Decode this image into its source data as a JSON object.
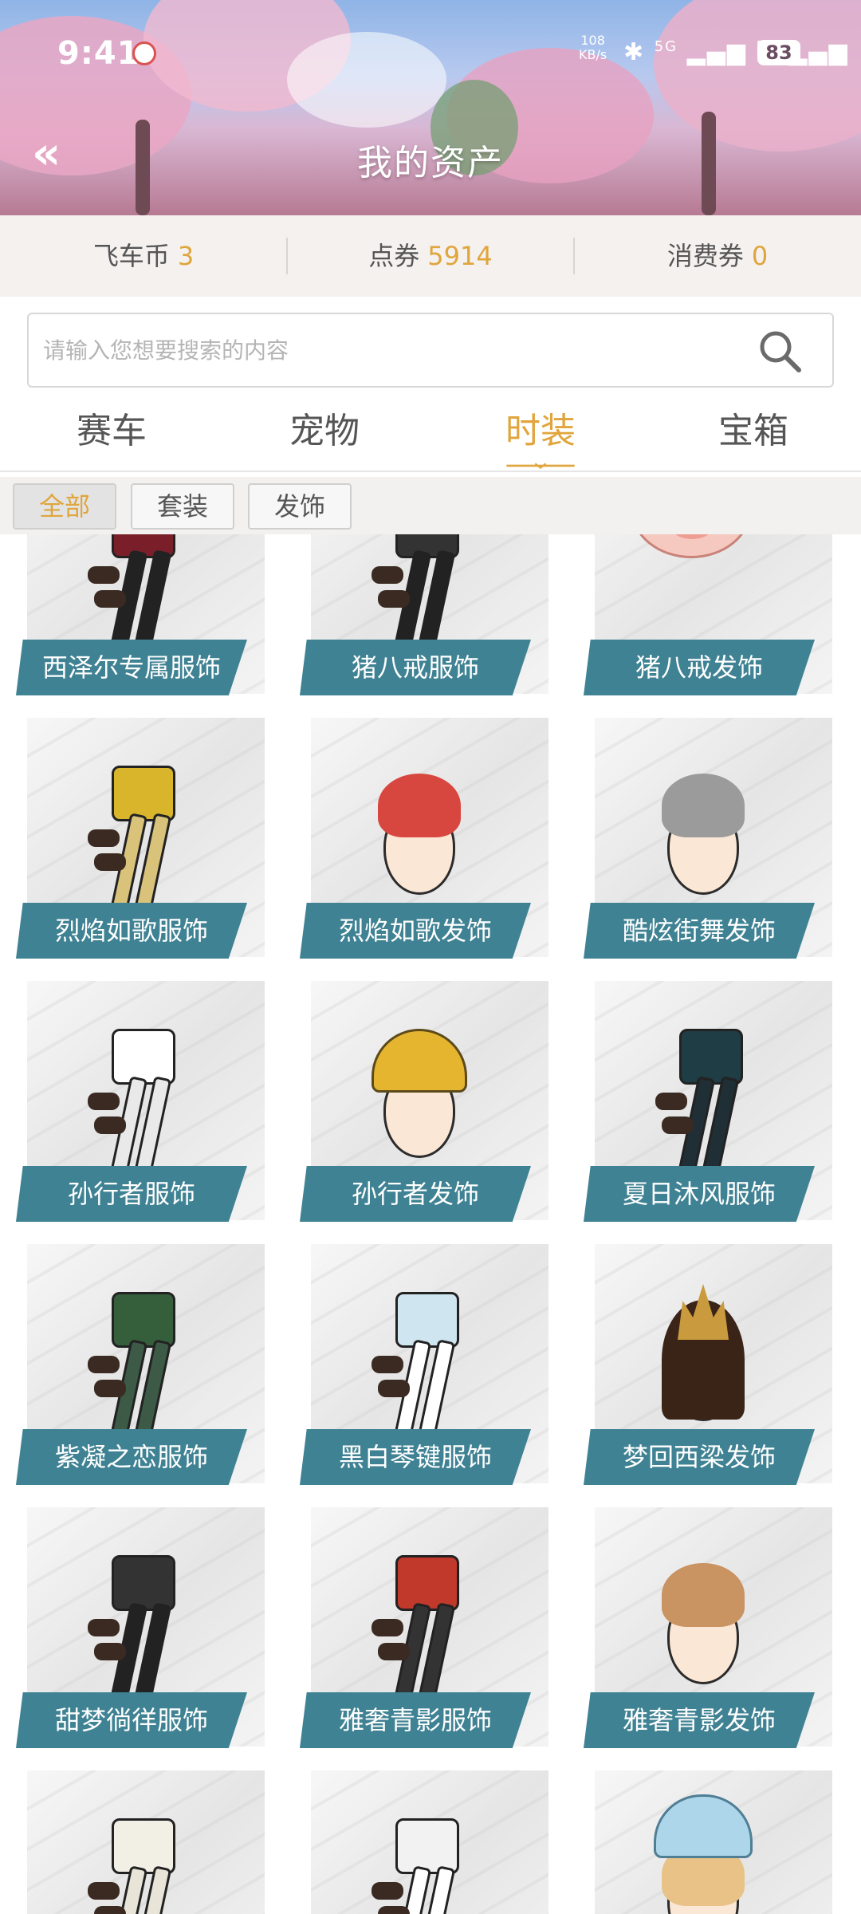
{
  "status_bar": {
    "time": "9:41",
    "net_speed_value": "108",
    "net_speed_unit": "KB/s",
    "signal_1": "5G",
    "signal_2": "5G",
    "battery": "83"
  },
  "header": {
    "title": "我的资产",
    "back_icon": "double-chevron-left-icon"
  },
  "balances": [
    {
      "label": "飞车币",
      "value": "3"
    },
    {
      "label": "点券",
      "value": "5914"
    },
    {
      "label": "消费券",
      "value": "0"
    }
  ],
  "search": {
    "placeholder": "请输入您想要搜索的内容",
    "icon": "search-icon"
  },
  "tabs": [
    {
      "label": "赛车",
      "active": false
    },
    {
      "label": "宠物",
      "active": false
    },
    {
      "label": "时装",
      "active": true
    },
    {
      "label": "宝箱",
      "active": false
    }
  ],
  "filters": [
    {
      "label": "全部",
      "active": true
    },
    {
      "label": "套装",
      "active": false
    },
    {
      "label": "发饰",
      "active": false
    }
  ],
  "items": [
    {
      "name": "西泽尔专属服饰",
      "kind": "outfit"
    },
    {
      "name": "猪八戒服饰",
      "kind": "outfit"
    },
    {
      "name": "猪八戒发饰",
      "kind": "pig"
    },
    {
      "name": "烈焰如歌服饰",
      "kind": "outfit"
    },
    {
      "name": "烈焰如歌发饰",
      "kind": "hair-red"
    },
    {
      "name": "酷炫街舞发饰",
      "kind": "hair-grey"
    },
    {
      "name": "孙行者服饰",
      "kind": "outfit"
    },
    {
      "name": "孙行者发饰",
      "kind": "cap"
    },
    {
      "name": "夏日沐风服饰",
      "kind": "outfit"
    },
    {
      "name": "紫凝之恋服饰",
      "kind": "outfit"
    },
    {
      "name": "黑白琴键服饰",
      "kind": "outfit"
    },
    {
      "name": "梦回西梁发饰",
      "kind": "crown"
    },
    {
      "name": "甜梦徜徉服饰",
      "kind": "outfit"
    },
    {
      "name": "雅奢青影服饰",
      "kind": "outfit"
    },
    {
      "name": "雅奢青影发饰",
      "kind": "hair-blond"
    },
    {
      "name": "",
      "kind": "outfit"
    },
    {
      "name": "",
      "kind": "outfit"
    },
    {
      "name": "",
      "kind": "beanie"
    }
  ],
  "colors": {
    "accent": "#e0a53b",
    "label_bg": "#3f8293",
    "balance_bg": "#f4f1ef"
  }
}
